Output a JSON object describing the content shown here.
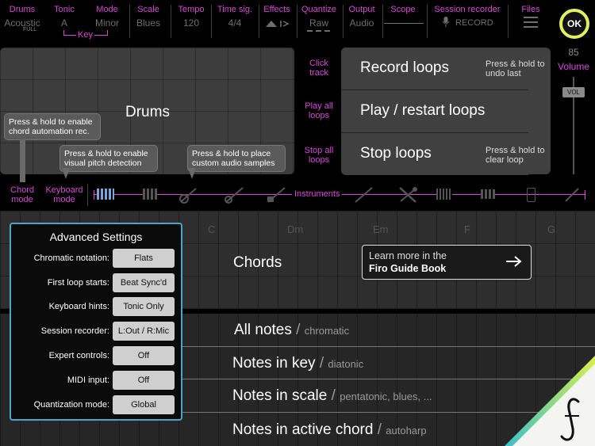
{
  "topbar": {
    "drums": {
      "title": "Drums",
      "value": "Acoustic",
      "sub": "FULL"
    },
    "tonic": {
      "title": "Tonic",
      "value": "A"
    },
    "mode": {
      "title": "Mode",
      "value": "Minor"
    },
    "key_label": "Key",
    "scale": {
      "title": "Scale",
      "value": "Blues"
    },
    "tempo": {
      "title": "Tempo",
      "value": "120"
    },
    "timesig": {
      "title": "Time sig.",
      "value": "4/4"
    },
    "effects": {
      "title": "Effects"
    },
    "quantize": {
      "title": "Quantize",
      "value": "Raw"
    },
    "output": {
      "title": "Output",
      "value": "Audio"
    },
    "scope": {
      "title": "Scope"
    },
    "recorder": {
      "title": "Session recorder",
      "value": "RECORD"
    },
    "files": {
      "title": "Files"
    },
    "ok_label": "OK"
  },
  "drums_pad": {
    "label": "Drums"
  },
  "loop_side": {
    "click_track": "Click track",
    "play_all": "Play all loops",
    "stop_all": "Stop all loops"
  },
  "loop_buttons": [
    {
      "label": "Record loops",
      "hint": "Press & hold to undo last"
    },
    {
      "label": "Play / restart loops",
      "hint": ""
    },
    {
      "label": "Stop loops",
      "hint": "Press & hold to clear loop"
    }
  ],
  "volume": {
    "value": "85",
    "label": "Volume",
    "knob": "VOL",
    "level": 0.88
  },
  "tips": {
    "chord_auto": "Press & hold to enable chord automation rec.",
    "pitch_detect": "Press & hold to enable visual pitch detection",
    "samples": "Press & hold to place custom audio samples"
  },
  "bottom_labels": {
    "chord_mode": "Chord mode",
    "keyboard_mode": "Keyboard mode",
    "instruments": "Instruments"
  },
  "settings": {
    "title": "Advanced Settings",
    "rows": [
      {
        "label": "Chromatic notation:",
        "value": "Flats"
      },
      {
        "label": "First loop starts:",
        "value": "Beat Sync'd"
      },
      {
        "label": "Keyboard hints:",
        "value": "Tonic Only"
      },
      {
        "label": "Session recorder:",
        "value": "L:Out / R:Mic"
      },
      {
        "label": "Expert controls:",
        "value": "Off"
      },
      {
        "label": "MIDI input:",
        "value": "Off"
      },
      {
        "label": "Quantization mode:",
        "value": "Global"
      }
    ]
  },
  "chord_keys": [
    "C",
    "Dm",
    "Em",
    "F",
    "G"
  ],
  "modes": {
    "chords": "Chords",
    "guide_line1": "Learn more in the",
    "guide_line2": "Firo Guide Book",
    "all_notes": "All notes",
    "all_notes_sub": "chromatic",
    "in_key": "Notes in key",
    "in_key_sub": "diatonic",
    "in_scale": "Notes in scale",
    "in_scale_sub": "pentatonic, blues, ...",
    "in_chord": "Notes in active chord",
    "in_chord_sub": "autoharp"
  },
  "colors": {
    "accent": "#e040e0",
    "settings_border": "#49a6c8",
    "ok_ring": "#e4f05a",
    "logo_gradient_start": "#3ec0c8",
    "logo_gradient_end": "#d8f04a"
  }
}
